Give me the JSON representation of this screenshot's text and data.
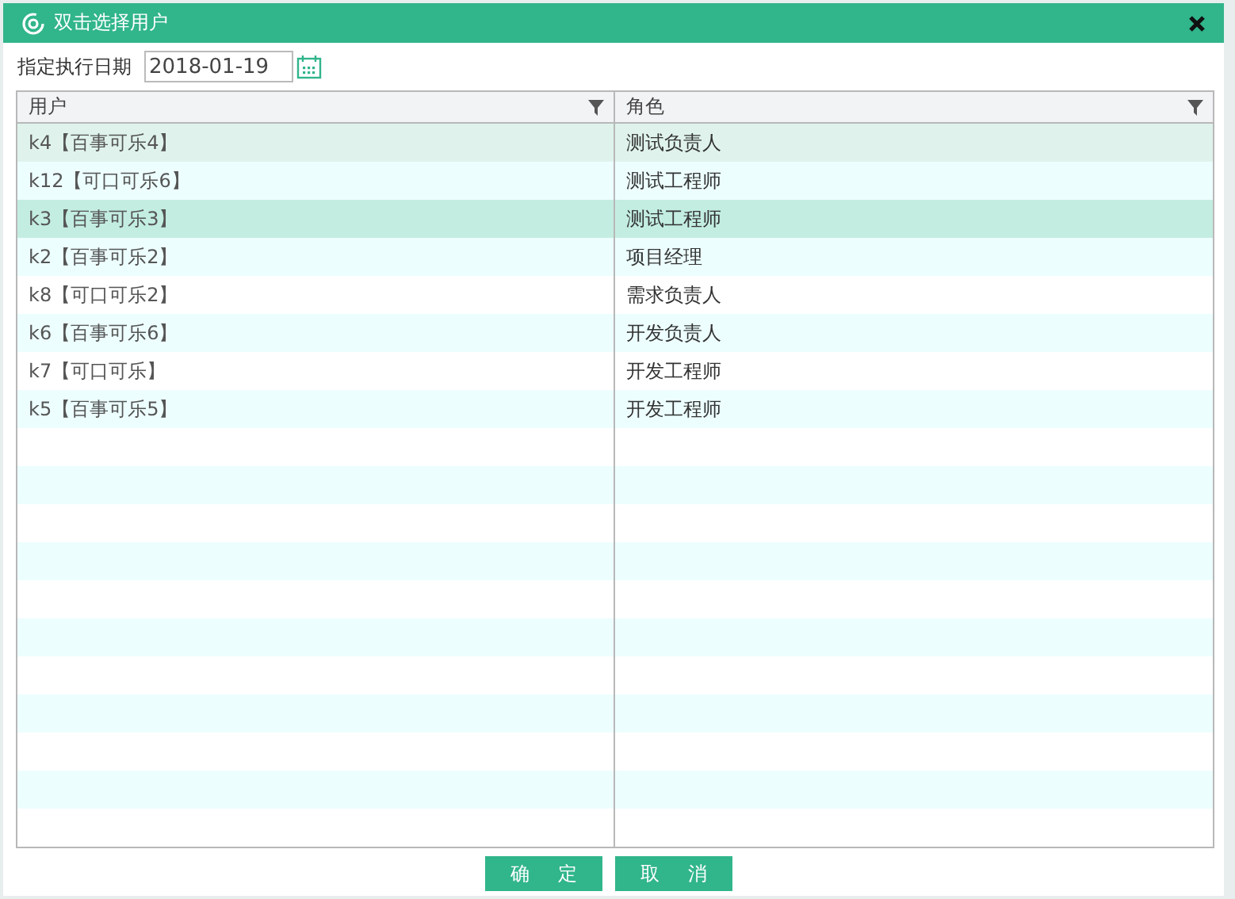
{
  "window": {
    "title": "双击选择用户"
  },
  "date_field": {
    "label": "指定执行日期",
    "value": "2018-01-19"
  },
  "table": {
    "columns": [
      "用户",
      "角色"
    ],
    "rows": [
      {
        "user": "k4【百事可乐4】",
        "role": "测试负责人",
        "selected": false,
        "hovered": true
      },
      {
        "user": "k12【可口可乐6】",
        "role": "测试工程师",
        "selected": false,
        "hovered": false
      },
      {
        "user": "k3【百事可乐3】",
        "role": "测试工程师",
        "selected": true,
        "hovered": false
      },
      {
        "user": "k2【百事可乐2】",
        "role": "项目经理",
        "selected": false,
        "hovered": false
      },
      {
        "user": "k8【可口可乐2】",
        "role": "需求负责人",
        "selected": false,
        "hovered": false
      },
      {
        "user": "k6【百事可乐6】",
        "role": "开发负责人",
        "selected": false,
        "hovered": false
      },
      {
        "user": "k7【可口可乐】",
        "role": "开发工程师",
        "selected": false,
        "hovered": false
      },
      {
        "user": "k5【百事可乐5】",
        "role": "开发工程师",
        "selected": false,
        "hovered": false
      }
    ]
  },
  "buttons": [
    "确定",
    "取消"
  ]
}
